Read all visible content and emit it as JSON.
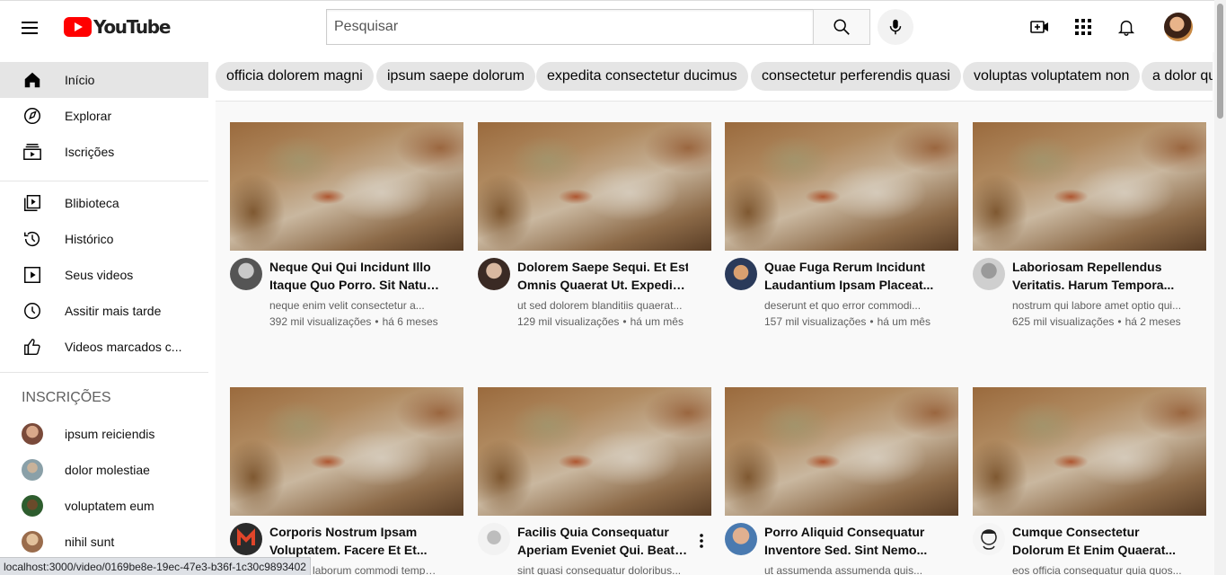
{
  "header": {
    "logo_text": "YouTube",
    "search_placeholder": "Pesquisar"
  },
  "sidebar": {
    "main": [
      {
        "label": "Início",
        "icon": "home-icon"
      },
      {
        "label": "Explorar",
        "icon": "compass-icon"
      },
      {
        "label": "Iscrições",
        "icon": "subscriptions-icon"
      }
    ],
    "library": [
      {
        "label": "Blibioteca",
        "icon": "library-icon"
      },
      {
        "label": "Histórico",
        "icon": "history-icon"
      },
      {
        "label": "Seus videos",
        "icon": "your-videos-icon"
      },
      {
        "label": "Assitir mais tarde",
        "icon": "watch-later-icon"
      },
      {
        "label": "Videos marcados c...",
        "icon": "thumbs-up-icon"
      }
    ],
    "subscriptions_title": "INSCRIÇÕES",
    "subscriptions": [
      {
        "label": "ipsum reiciendis",
        "color": "#7a4a3a"
      },
      {
        "label": "dolor molestiae",
        "color": "#8aa0a8"
      },
      {
        "label": "voluptatem eum",
        "color": "#2e5d2e"
      },
      {
        "label": "nihil sunt",
        "color": "#c49a6c"
      }
    ]
  },
  "chips": [
    "officia dolorem magni",
    "ipsum saepe dolorum",
    "expedita consectetur ducimus",
    "consectetur perferendis quasi",
    "voluptas voluptatem non",
    "a dolor quia"
  ],
  "videos": [
    {
      "title_l1": "Neque Qui Qui Incidunt Illo",
      "title_l2": "Itaque Quo Porro. Sit Natus...",
      "desc": "neque enim velit consectetur a...",
      "views": "392 mil visualizações",
      "age": "há 6 meses",
      "avatar_color": "#555"
    },
    {
      "title_l1": "Dolorem Saepe Sequi. Et Est",
      "title_l2": "Omnis Quaerat Ut. Expedita...",
      "desc": "ut sed dolorem blanditiis quaerat...",
      "views": "129 mil visualizações",
      "age": "há um mês",
      "avatar_color": "#3a2a24"
    },
    {
      "title_l1": "Quae Fuga Rerum Incidunt",
      "title_l2": "Laudantium Ipsam Placeat...",
      "desc": "deserunt et quo error commodi...",
      "views": "157 mil visualizações",
      "age": "há um mês",
      "avatar_color": "#c08a5a"
    },
    {
      "title_l1": "Laboriosam Repellendus",
      "title_l2": "Veritatis. Harum Tempora...",
      "desc": "nostrum qui labore amet optio qui...",
      "views": "625 mil visualizações",
      "age": "há 2 meses",
      "avatar_color": "#b0b0b0"
    },
    {
      "title_l1": "Corporis Nostrum Ipsam",
      "title_l2": "Voluptatem. Facere Et Et...",
      "desc": "nesciunt laborum commodi tempo...",
      "views": "",
      "age": "",
      "avatar_color": "#2b2b2b"
    },
    {
      "title_l1": "Facilis Quia Consequatur",
      "title_l2": "Aperiam Eveniet Qui. Beata...",
      "desc": "sint quasi consequatur doloribus...",
      "views": "",
      "age": "",
      "avatar_color": "#e8e8e8"
    },
    {
      "title_l1": "Porro Aliquid Consequatur",
      "title_l2": "Inventore Sed. Sint Nemo...",
      "desc": "ut assumenda assumenda quis...",
      "views": "",
      "age": "",
      "avatar_color": "#4a7ab0"
    },
    {
      "title_l1": "Cumque Consectetur",
      "title_l2": "Dolorum Et Enim Quaerat...",
      "desc": "eos officia consequatur quia quos...",
      "views": "",
      "age": "",
      "avatar_color": "#f0f0f0"
    }
  ],
  "status_url": "localhost:3000/video/0169be8e-19ec-47e3-b36f-1c30c9893402"
}
